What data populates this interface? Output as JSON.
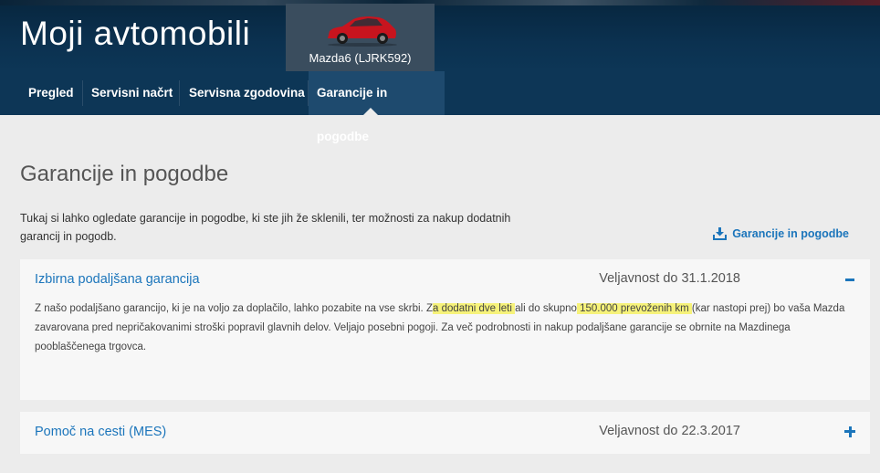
{
  "header": {
    "app_title": "Moji avtomobili",
    "car_label": "Mazda6 (LJRK592)",
    "car_color": "#c8141e"
  },
  "nav": {
    "items": [
      {
        "label": "Pregled",
        "active": false
      },
      {
        "label": "Servisni načrt",
        "active": false
      },
      {
        "label": "Servisna zgodovina",
        "active": false
      },
      {
        "label": "Garancije in pogodbe",
        "active": true
      }
    ]
  },
  "main": {
    "title": "Garancije in pogodbe",
    "intro": "Tukaj si lahko ogledate garancije in pogodbe, ki ste jih že sklenili, ter možnosti za nakup dodatnih garancij in pogodb.",
    "download_label": "Garancije in pogodbe",
    "download_icon": "download-icon",
    "accent_color": "#1b75bb"
  },
  "panels": [
    {
      "title": "Izbirna podaljšana garancija",
      "validity": "Veljavnost do 31.1.2018",
      "expanded": true,
      "toggle_icon": "minus-icon",
      "body": {
        "part1": "Z našo podaljšano garancijo, ki je na voljo za doplačilo, lahko pozabite na vse skrbi. Z",
        "hl1": "a dodatni dve leti ",
        "part2": "ali do skupno",
        "hl2": " 150.000 prevoženih km ",
        "part3": "(kar nastopi prej) bo vaša Mazda zavarovana pred nepričakovanimi stroški popravil glavnih delov. Veljajo posebni pogoji. Za več podrobnosti in nakup podaljšane garancije se obrnite na Mazdinega pooblaščenega trgovca."
      }
    },
    {
      "title": "Pomoč na cesti (MES)",
      "validity": "Veljavnost do 22.3.2017",
      "expanded": false,
      "toggle_icon": "plus-icon"
    }
  ]
}
